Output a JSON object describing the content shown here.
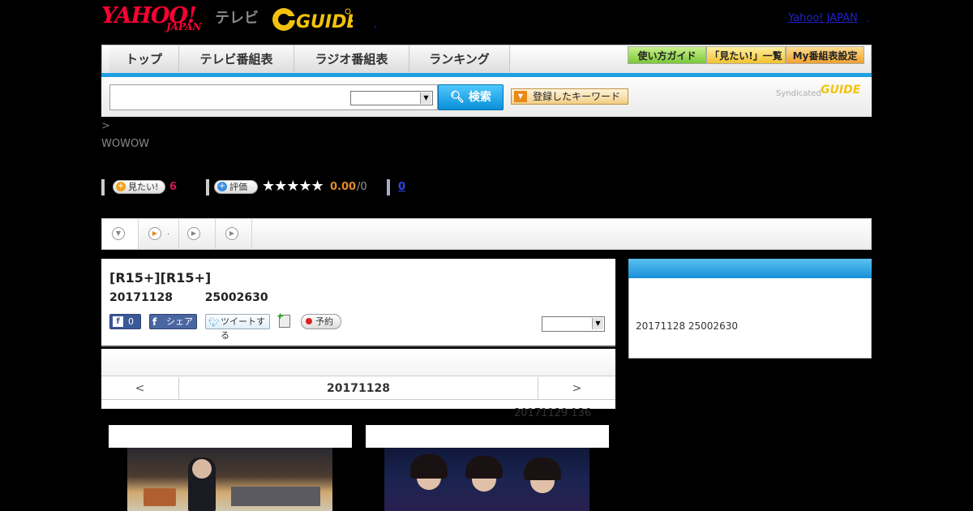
{
  "header": {
    "yahoo_logo": "YAHOO!",
    "yahoo_japan": "JAPAN",
    "tv_label": "テレビ",
    "gguide_logo": "GUIDE",
    "yahoo_japan_link": "Yahoo! JAPAN",
    "link_separator": ".",
    "header_dot": ","
  },
  "nav": {
    "tabs": [
      "トップ",
      "テレビ番組表",
      "ラジオ番組表",
      "ランキング"
    ],
    "buttons": [
      "使い方ガイド",
      "「見たい!」一覧",
      "My番組表設定"
    ],
    "button_colors": [
      "#9be05a",
      "#ffd24a",
      "#ffb84a"
    ]
  },
  "search": {
    "placeholder": "",
    "select_value": "",
    "search_label": "検索",
    "keyword_label": "登録したキーワード",
    "syndicated_label": "Syndicated",
    "syndicated_logo": "GUIDE"
  },
  "crumb": ">",
  "channel": "WOWOW",
  "ratings": {
    "mitai_label": "見たい!",
    "mitai_count": "6",
    "hyoka_label": "評価",
    "stars": "★★★★★",
    "score": "0.00",
    "score_count": "/0",
    "review_link": "0"
  },
  "tabstrip": {
    "tab2_dot": "."
  },
  "program": {
    "title": "[R15+][R15+]",
    "date": "20171128",
    "time": "25002630",
    "fb_like_count": "0",
    "fb_share_label": "シェア",
    "tweet_label": "ツイートする",
    "reserve_label": "予約",
    "select_value": ""
  },
  "datenav": {
    "prev": "<",
    "current": "20171128",
    "next": ">",
    "updated": "20171129  136"
  },
  "sidebar": {
    "text": "20171128  25002630"
  },
  "colors": {
    "accent_blue": "#1ea0e0",
    "yahoo_red": "#ff0033",
    "mitai_pink": "#d0145a",
    "score_orange": "#e0892c"
  }
}
